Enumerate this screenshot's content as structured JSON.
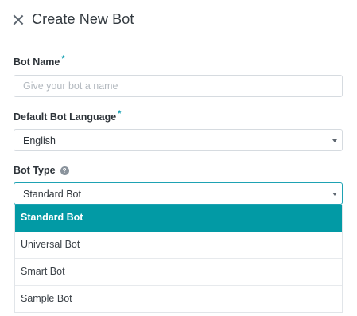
{
  "header": {
    "title": "Create New Bot",
    "close_icon": "close-icon"
  },
  "bot_name": {
    "label": "Bot Name",
    "required_mark": "*",
    "value": "",
    "placeholder": "Give your bot a name"
  },
  "language": {
    "label": "Default Bot Language",
    "required_mark": "*",
    "selected": "English"
  },
  "bot_type": {
    "label": "Bot Type",
    "help_icon": "question-circle-icon",
    "help_glyph": "?",
    "selected": "Standard Bot",
    "options": [
      "Standard Bot",
      "Universal Bot",
      "Smart Bot",
      "Sample Bot"
    ]
  },
  "colors": {
    "accent": "#029aa5",
    "required": "#15a0b3",
    "border": "#d6dbe0"
  }
}
